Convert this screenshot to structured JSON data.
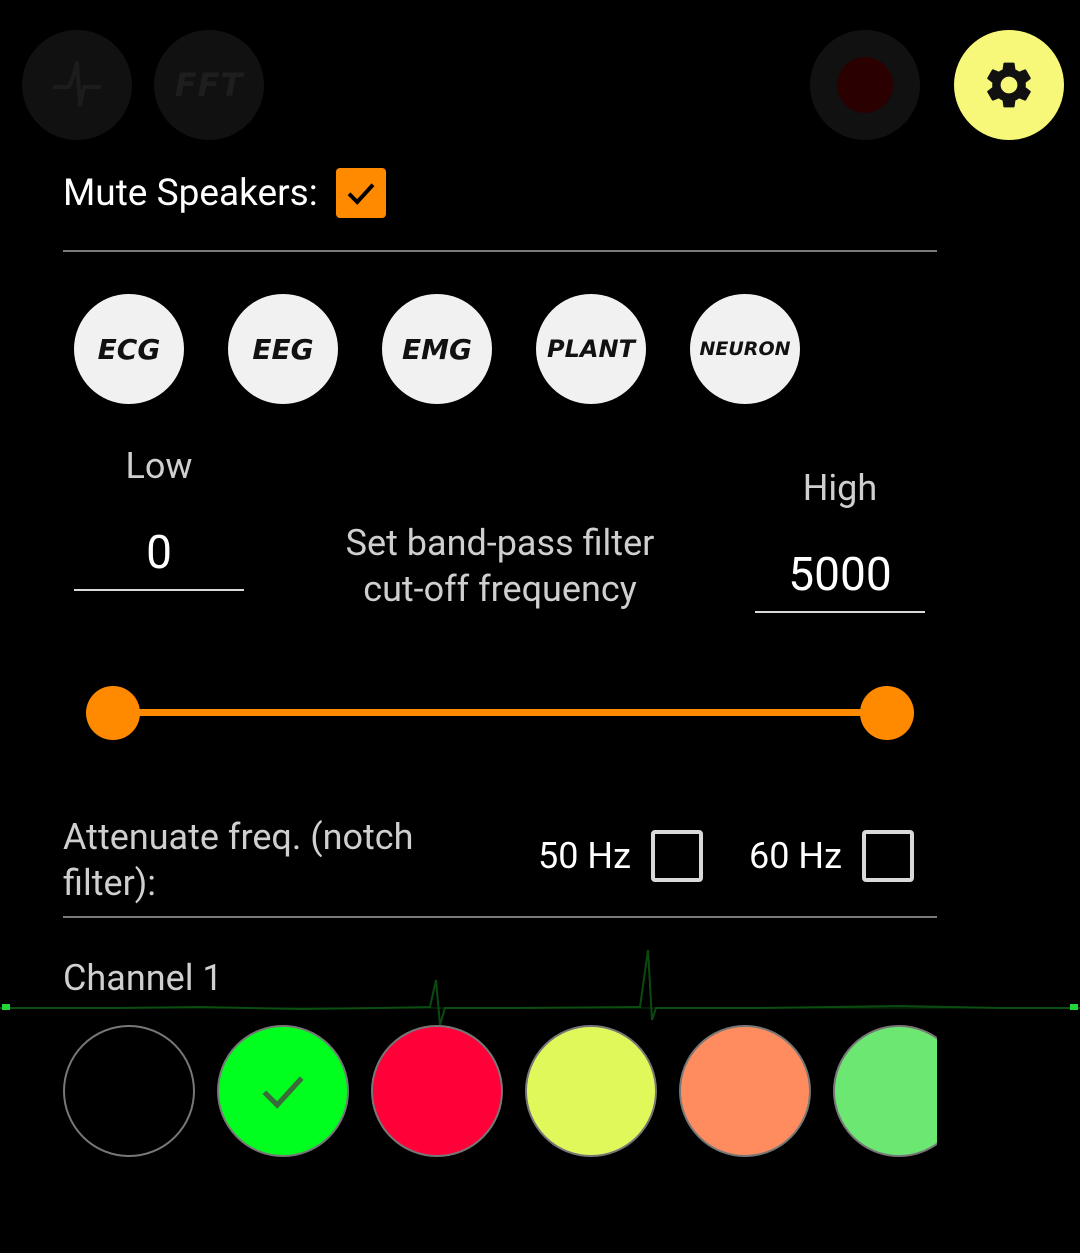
{
  "toolbar": {
    "signal_icon": "waveform-icon",
    "fft_label": "FFT",
    "record_icon": "record-icon",
    "settings_icon": "gear-icon",
    "settings_color": "#f7f77a"
  },
  "mute": {
    "label": "Mute Speakers:",
    "checked": true,
    "accent": "#ff8a00"
  },
  "presets": [
    "ECG",
    "EEG",
    "EMG",
    "PLANT",
    "NEURON"
  ],
  "filter": {
    "low_label": "Low",
    "low_value": "0",
    "high_label": "High",
    "high_value": "5000",
    "caption_line1": "Set band-pass filter",
    "caption_line2": "cut-off frequency",
    "slider_low_fraction": 0,
    "slider_high_fraction": 1
  },
  "notch": {
    "label_line1": "Attenuate freq. (notch",
    "label_line2": "filter):",
    "opt50_label": "50 Hz",
    "opt50_checked": false,
    "opt60_label": "60 Hz",
    "opt60_checked": false
  },
  "channel": {
    "label": "Channel 1",
    "colors": [
      "#000000",
      "#00ff1e",
      "#ff0039",
      "#e1f85a",
      "#ff8c5e",
      "#6ce872"
    ],
    "selected_index": 1
  }
}
